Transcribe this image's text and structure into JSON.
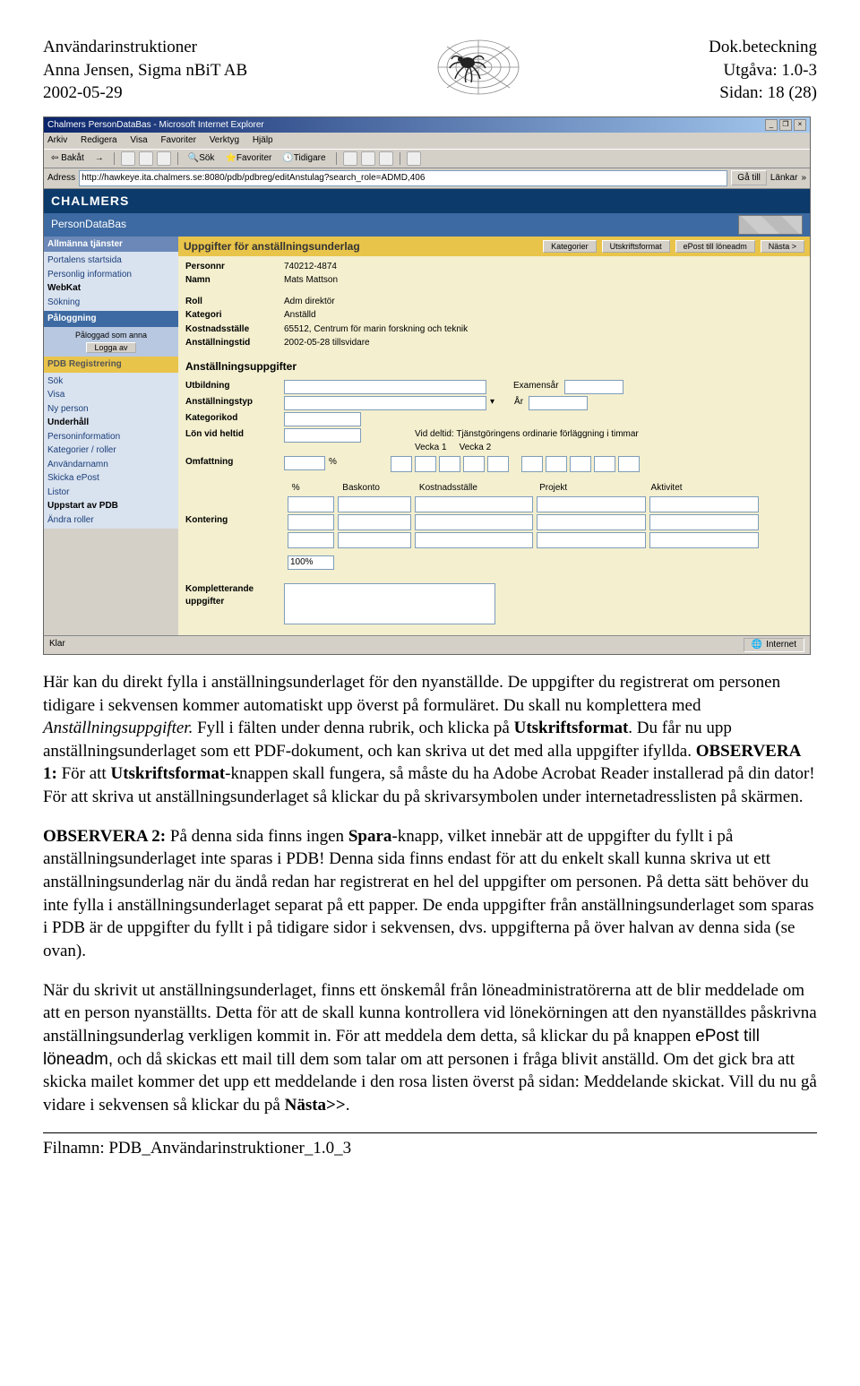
{
  "header": {
    "left": {
      "title": "Användarinstruktioner",
      "author": "Anna Jensen, Sigma nBiT AB",
      "date": "2002-05-29"
    },
    "right": {
      "dok": "Dok.beteckning",
      "utgava": "Utgåva: 1.0-3",
      "sidan": "Sidan: 18 (28)"
    }
  },
  "browser": {
    "title": "Chalmers PersonDataBas - Microsoft Internet Explorer",
    "menu": [
      "Arkiv",
      "Redigera",
      "Visa",
      "Favoriter",
      "Verktyg",
      "Hjälp"
    ],
    "back": "Bakåt",
    "toolbar_btns": [
      "Sök",
      "Favoriter",
      "Tidigare"
    ],
    "address_label": "Adress",
    "url": "http://hawkeye.ita.chalmers.se:8080/pdb/pdbreg/editAnstulag?search_role=ADMD,406",
    "go": "Gå till",
    "links": "Länkar",
    "status_left": "Klar",
    "status_zone": "Internet"
  },
  "chalmers": {
    "logo": "CHALMERS",
    "subtitle": "PersonDataBas"
  },
  "sidebar": {
    "sec1": {
      "title": "Allmänna tjänster",
      "items": [
        "Portalens startsida",
        "Personlig information",
        "WebKat",
        "Sökning"
      ]
    },
    "sec2": {
      "title": "Påloggning",
      "status": "Påloggad som anna",
      "logout": "Logga av"
    },
    "sec3": {
      "title": "PDB Registrering",
      "items": [
        "Sök",
        "Visa",
        "Ny person",
        "Underhåll",
        "Personinformation",
        "Kategorier / roller",
        "Användarnamn",
        "Skicka ePost",
        "Listor",
        "Uppstart av PDB",
        "Ändra roller"
      ],
      "bold_indices": [
        3,
        9
      ]
    }
  },
  "form": {
    "title": "Uppgifter för anställningsunderlag",
    "btns": [
      "Kategorier",
      "Utskriftsformat",
      "ePost till löneadm",
      "Nästa >"
    ],
    "fields1": [
      {
        "lbl": "Personnr",
        "val": "740212-4874"
      },
      {
        "lbl": "Namn",
        "val": "Mats Mattson"
      }
    ],
    "fields2": [
      {
        "lbl": "Roll",
        "val": "Adm direktör"
      },
      {
        "lbl": "Kategori",
        "val": "Anställd"
      },
      {
        "lbl": "Kostnadsställe",
        "val": "65512, Centrum för marin forskning och teknik"
      },
      {
        "lbl": "Anställningstid",
        "val": "2002-05-28 tillsvidare"
      }
    ],
    "sec2_title": "Anställningsuppgifter",
    "row_utbildning": {
      "lbl": "Utbildning",
      "lbl2": "Examensår"
    },
    "row_anstyp": {
      "lbl": "Anställningstyp",
      "lbl2": "År"
    },
    "row_kategorikod": "Kategorikod",
    "row_lon": "Lön vid heltid",
    "row_omf": "Omfattning",
    "omf_unit": "%",
    "deltid_label": "Vid deltid: Tjänstgöringens ordinarie förläggning i timmar",
    "vecka1": "Vecka 1",
    "vecka2": "Vecka 2",
    "kont_headers": [
      "%",
      "Baskonto",
      "Kostnadsställe",
      "Projekt",
      "Aktivitet"
    ],
    "kontering": "Kontering",
    "total": "100%",
    "kompletterande": "Kompletterande uppgifter"
  },
  "body": {
    "p1a": "Här kan du direkt fylla i anställningsunderlaget för den nyanställde. De uppgifter du registrerat om personen tidigare i sekvensen kommer automatiskt upp överst på formuläret. Du skall nu komplettera med ",
    "p1b": "Anställningsuppgifter.",
    "p1c": " Fyll i fälten under denna rubrik, och klicka på ",
    "p1d": "Utskriftsformat",
    "p1e": ". Du får nu upp anställningsunderlaget som ett PDF-dokument, och kan skriva ut det med alla uppgifter ifyllda. ",
    "p1f": "OBSERVERA 1:",
    "p1g": " För att ",
    "p1h": "Utskriftsformat",
    "p1i": "-knappen skall fungera, så måste du ha Adobe Acrobat Reader installerad på din dator! För att skriva ut anställningsunderlaget så klickar du på skrivarsymbolen under internetadresslisten på skärmen.",
    "p2a": "OBSERVERA 2:",
    "p2b": " På denna sida finns ingen ",
    "p2c": "Spara",
    "p2d": "-knapp, vilket innebär att de uppgifter du fyllt i på anställningsunderlaget inte sparas i PDB! Denna sida finns endast för att du enkelt skall kunna skriva ut ett anställningsunderlag när du ändå redan har registrerat en hel del uppgifter om personen. På detta sätt behöver du inte fylla i anställningsunderlaget separat på ett papper. De enda uppgifter från anställningsunderlaget som sparas i PDB är de uppgifter du fyllt i på tidigare sidor i sekvensen, dvs. uppgifterna på över halvan av denna sida (se ovan).",
    "p3a": "När du skrivit ut anställningsunderlaget, finns ett önskemål från löneadministratörerna att de blir meddelade om att en person nyanställts. Detta för att de skall kunna kontrollera vid lönekörningen att den nyanställdes påskrivna anställningsunderlag verkligen kommit in. För att meddela dem detta, så klickar du på knappen ",
    "p3b": "ePost till löneadm,",
    "p3c": " och då skickas ett mail till dem som talar om att personen i fråga blivit anställd. Om det gick bra att skicka mailet kommer det upp ett meddelande i den rosa listen överst på sidan: Meddelande skickat. Vill du nu gå vidare i sekvensen så klickar du på ",
    "p3d": "Nästa>>",
    "p3e": "."
  },
  "footer": "Filnamn: PDB_Användarinstruktioner_1.0_3"
}
